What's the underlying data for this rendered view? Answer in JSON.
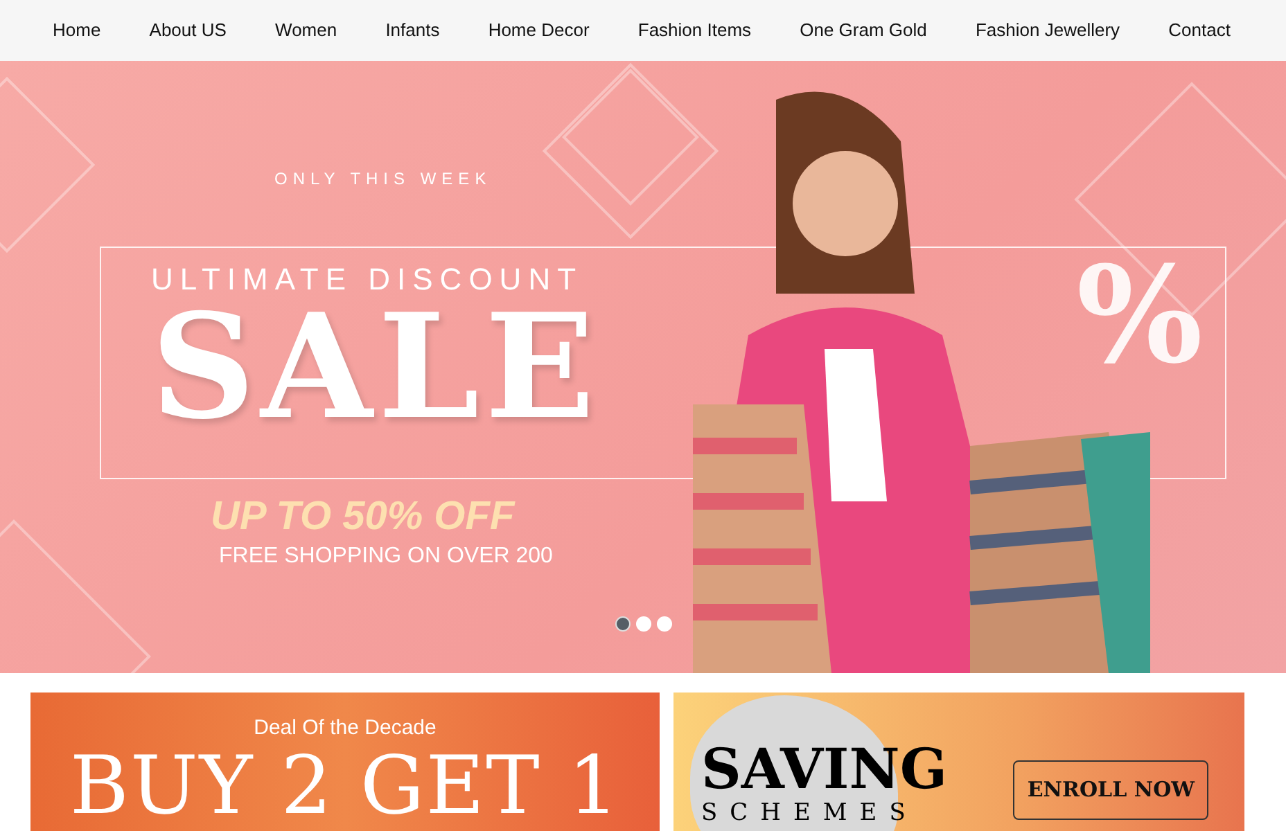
{
  "nav": {
    "items": [
      {
        "label": "Home"
      },
      {
        "label": "About US"
      },
      {
        "label": "Women"
      },
      {
        "label": "Infants"
      },
      {
        "label": "Home Decor"
      },
      {
        "label": "Fashion Items"
      },
      {
        "label": "One Gram Gold"
      },
      {
        "label": "Fashion Jewellery"
      },
      {
        "label": "Contact"
      }
    ]
  },
  "hero": {
    "eyebrow": "ONLY THIS WEEK",
    "subtitle": "ULTIMATE DISCOUNT",
    "title": "SALE",
    "percent": "%",
    "offer": "UP TO 50% OFF",
    "note": "FREE SHOPPING ON OVER 200",
    "dots": [
      {
        "selected": true
      },
      {
        "selected": false
      },
      {
        "selected": false
      }
    ]
  },
  "promos": [
    {
      "kind": "deal",
      "eyebrow": "Deal Of the Decade",
      "title": "BUY 2 GET 1"
    },
    {
      "kind": "scheme",
      "title": "SAVING",
      "subtitle": "SCHEMES",
      "button": "ENROLL NOW"
    }
  ]
}
